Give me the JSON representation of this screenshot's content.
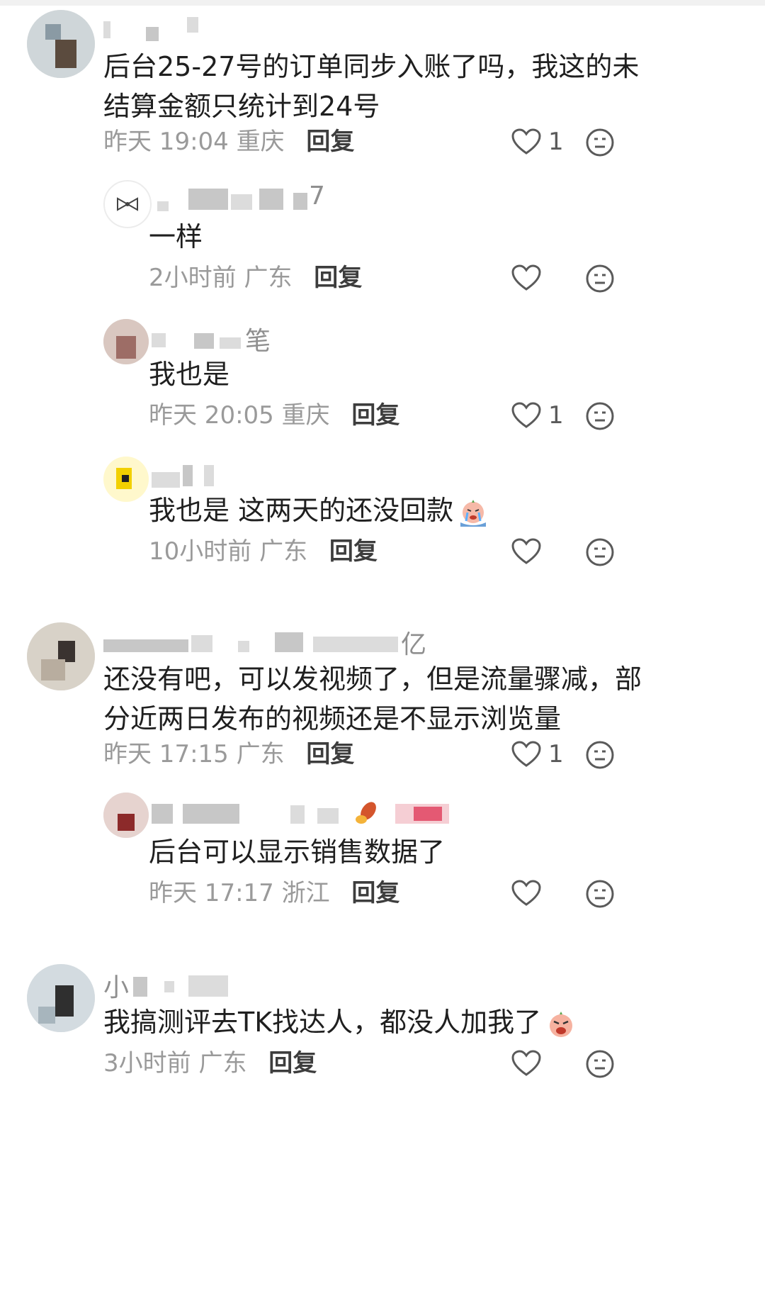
{
  "colors": {
    "text": "#1f1f1f",
    "meta": "#9a9a9a",
    "reply": "#3d3d3d",
    "icon": "#5a5a5a"
  },
  "comments": [
    {
      "author_visible": "",
      "content_lines": [
        "后台25-27号的订单同步入账了吗，我这的未",
        "结算金额只统计到24号"
      ],
      "time": "昨天 19:04",
      "location": "重庆",
      "reply_label": "回复",
      "likes": "1",
      "replies": [
        {
          "author_visible": "7",
          "content": "一样",
          "time": "2小时前",
          "location": "广东",
          "reply_label": "回复",
          "likes": ""
        },
        {
          "author_visible": "笔",
          "content": "我也是",
          "time": "昨天 20:05",
          "location": "重庆",
          "reply_label": "回复",
          "likes": "1"
        },
        {
          "author_visible": "",
          "content": "我也是 这两天的还没回款",
          "emoji": "crying-face-emoji",
          "time": "10小时前",
          "location": "广东",
          "reply_label": "回复",
          "likes": ""
        }
      ]
    },
    {
      "author_visible": "亿",
      "content_lines": [
        "还没有吧，可以发视频了，但是流量骤减，部",
        "分近两日发布的视频还是不显示浏览量"
      ],
      "time": "昨天 17:15",
      "location": "广东",
      "reply_label": "回复",
      "likes": "1",
      "replies": [
        {
          "author_visible": "",
          "content": "后台可以显示销售数据了",
          "time": "昨天 17:17",
          "location": "浙江",
          "reply_label": "回复",
          "likes": ""
        }
      ]
    },
    {
      "author_visible": "小",
      "content_lines": [
        "我搞测评去TK找达人，都没人加我了"
      ],
      "emoji": "angry-face-emoji",
      "time": "3小时前",
      "location": "广东",
      "reply_label": "回复",
      "likes": ""
    }
  ]
}
